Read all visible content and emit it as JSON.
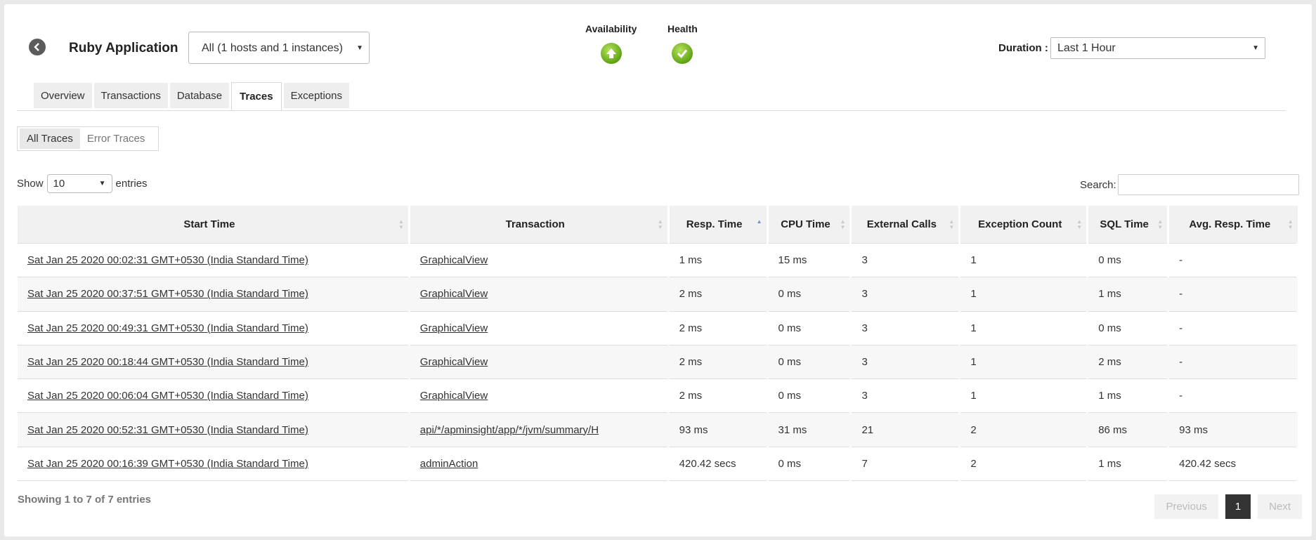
{
  "header": {
    "app_name": "Ruby Application",
    "host_select": "All (1 hosts and 1 instances)",
    "availability_label": "Availability",
    "health_label": "Health",
    "duration_label": "Duration :",
    "duration_value": "Last 1 Hour"
  },
  "tabs": [
    "Overview",
    "Transactions",
    "Database",
    "Traces",
    "Exceptions"
  ],
  "active_tab": "Traces",
  "subtabs": [
    "All Traces",
    "Error Traces"
  ],
  "length_control": {
    "show": "Show",
    "value": "10",
    "entries": "entries"
  },
  "search": {
    "label": "Search:"
  },
  "table": {
    "columns": [
      "Start Time",
      "Transaction",
      "Resp. Time",
      "CPU Time",
      "External Calls",
      "Exception Count",
      "SQL Time",
      "Avg. Resp. Time"
    ],
    "sorted_column": "Resp. Time",
    "rows": [
      [
        "Sat Jan 25 2020 00:02:31 GMT+0530 (India Standard Time)",
        "GraphicalView",
        "1 ms",
        "15 ms",
        "3",
        "1",
        "0 ms",
        "-"
      ],
      [
        "Sat Jan 25 2020 00:37:51 GMT+0530 (India Standard Time)",
        "GraphicalView",
        "2 ms",
        "0 ms",
        "3",
        "1",
        "1 ms",
        "-"
      ],
      [
        "Sat Jan 25 2020 00:49:31 GMT+0530 (India Standard Time)",
        "GraphicalView",
        "2 ms",
        "0 ms",
        "3",
        "1",
        "0 ms",
        "-"
      ],
      [
        "Sat Jan 25 2020 00:18:44 GMT+0530 (India Standard Time)",
        "GraphicalView",
        "2 ms",
        "0 ms",
        "3",
        "1",
        "2 ms",
        "-"
      ],
      [
        "Sat Jan 25 2020 00:06:04 GMT+0530 (India Standard Time)",
        "GraphicalView",
        "2 ms",
        "0 ms",
        "3",
        "1",
        "1 ms",
        "-"
      ],
      [
        "Sat Jan 25 2020 00:52:31 GMT+0530 (India Standard Time)",
        "api/*/apminsight/app/*/jvm/summary/H",
        "93 ms",
        "31 ms",
        "21",
        "2",
        "86 ms",
        "93 ms"
      ],
      [
        "Sat Jan 25 2020 00:16:39 GMT+0530 (India Standard Time)",
        "adminAction",
        "420.42 secs",
        "0 ms",
        "7",
        "2",
        "1 ms",
        "420.42 secs"
      ]
    ]
  },
  "footer": {
    "info": "Showing 1 to 7 of 7 entries",
    "previous": "Previous",
    "page": "1",
    "next": "Next"
  },
  "icons": {
    "back": "chevron-left-icon",
    "availability": "arrow-up-circle-icon",
    "health": "check-circle-icon"
  }
}
